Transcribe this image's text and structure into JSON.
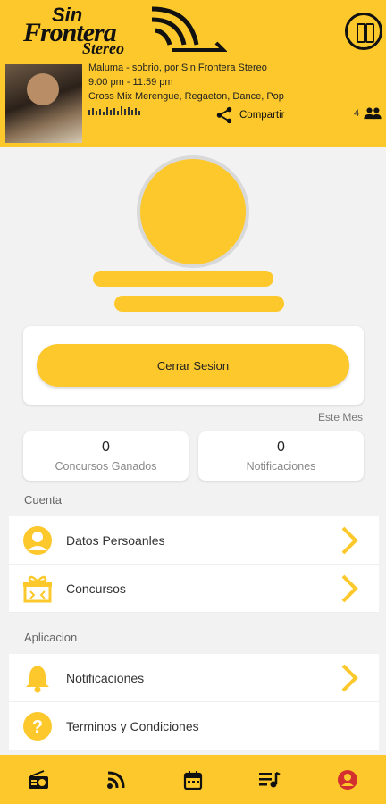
{
  "brand": {
    "line1": "Sin",
    "line2": "Frontera",
    "line3": "Stereo"
  },
  "now_playing": {
    "title_line": "Maluma  -  sobrio, por Sin Frontera Stereo",
    "time_line": "9:00 pm - 11:59 pm",
    "genre_line": "Cross Mix  Merengue, Regaeton, Dance, Pop",
    "share_label": "Compartir",
    "listeners": "4"
  },
  "profile": {
    "logout_label": "Cerrar Sesion"
  },
  "stats": {
    "period_label": "Este Mes",
    "contests_won": {
      "value": "0",
      "label": "Concursos Ganados"
    },
    "notifications": {
      "value": "0",
      "label": "Notificaciones"
    }
  },
  "account": {
    "heading": "Cuenta",
    "items": [
      {
        "label": "Datos Persoanles",
        "icon": "person-circle-icon"
      },
      {
        "label": "Concursos",
        "icon": "gift-icon"
      }
    ]
  },
  "app": {
    "heading": "Aplicacion",
    "items": [
      {
        "label": "Notificaciones",
        "icon": "bell-icon"
      },
      {
        "label": "Terminos y Condiciones",
        "icon": "help-icon"
      }
    ]
  },
  "tabs": [
    "radio-icon",
    "podcast-icon",
    "calendar-icon",
    "playlist-icon",
    "profile-icon"
  ],
  "colors": {
    "accent": "#fcc82b",
    "active_tab": "#d32f2f",
    "text": "#333333"
  }
}
